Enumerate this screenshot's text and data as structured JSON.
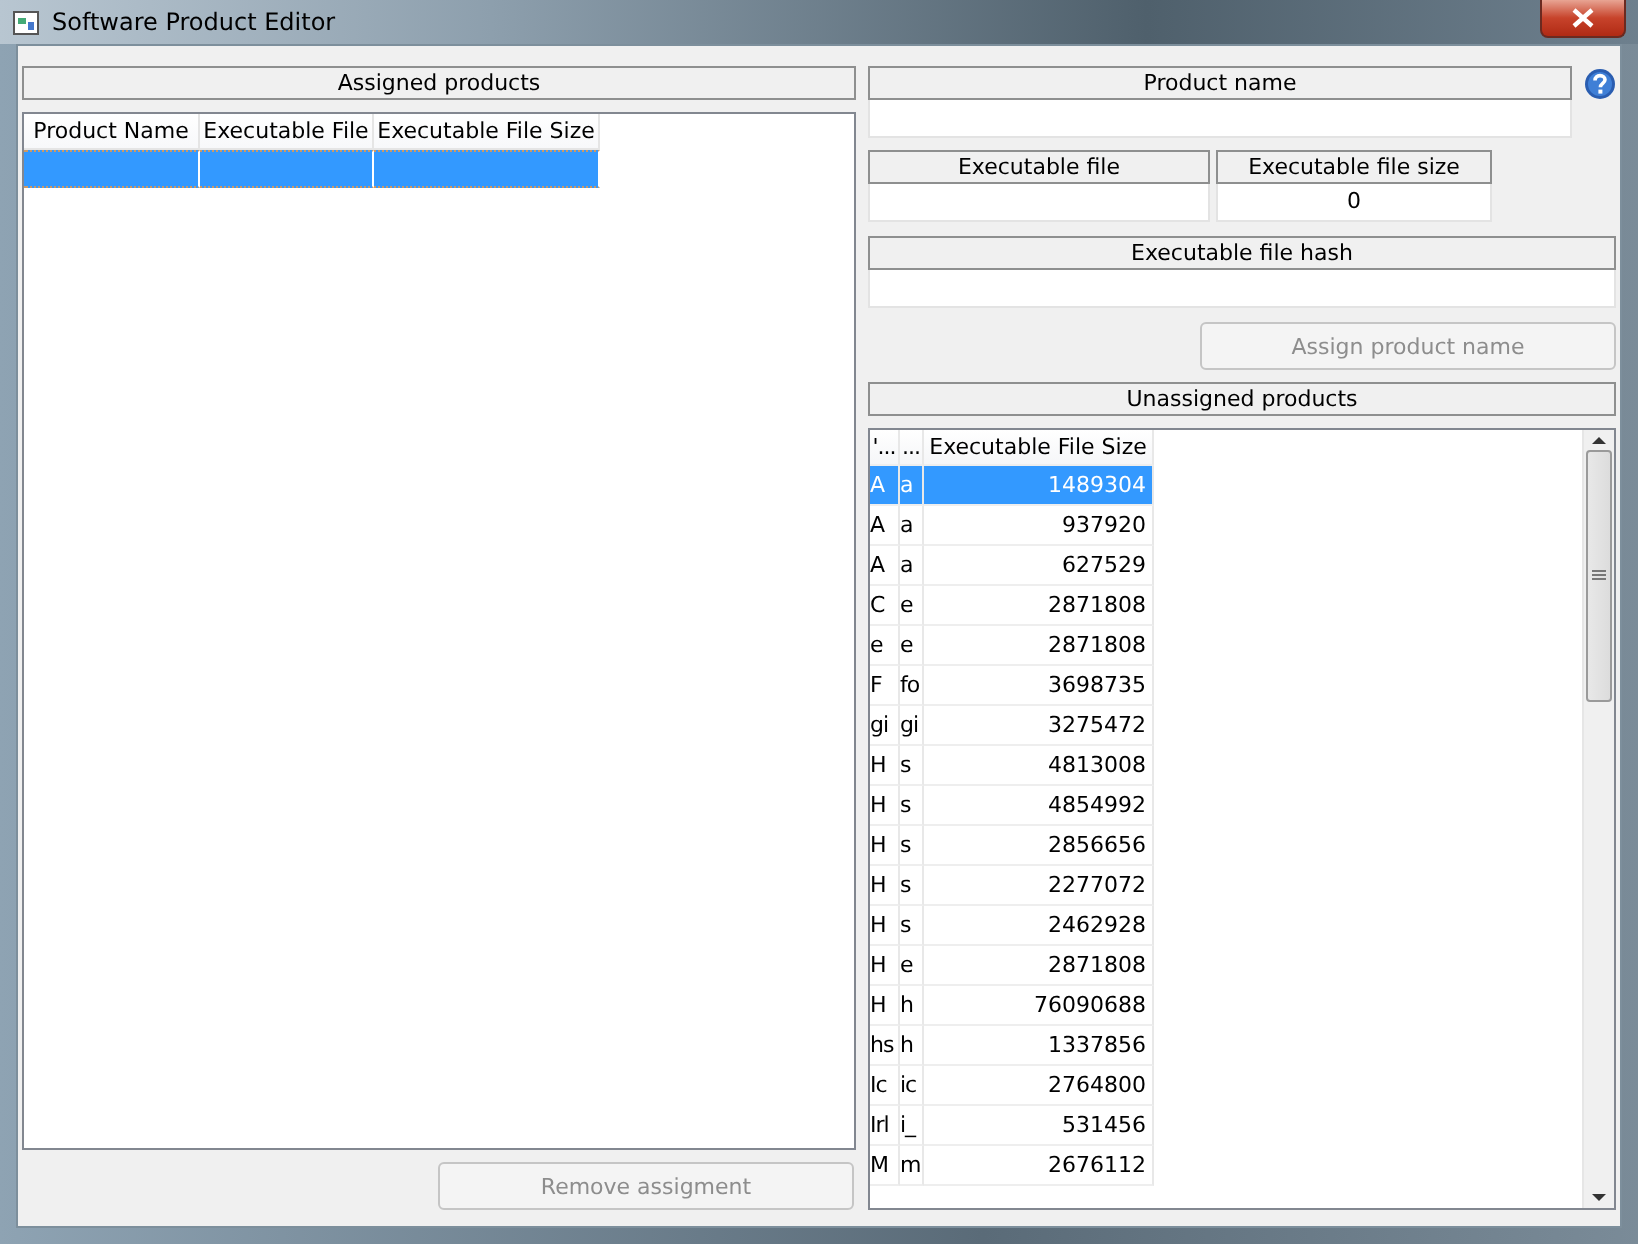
{
  "window": {
    "title": "Software Product Editor"
  },
  "assigned": {
    "title": "Assigned products",
    "columns": [
      "Product Name",
      "Executable File",
      "Executable File Size"
    ],
    "rows": [
      {
        "selected": true
      }
    ],
    "remove_button": {
      "label": "Remove assigment",
      "disabled": true
    }
  },
  "product_name": {
    "label": "Product name"
  },
  "executable_file": {
    "label": "Executable file"
  },
  "executable_file_size": {
    "label": "Executable file size",
    "value": "0"
  },
  "executable_file_hash": {
    "label": "Executable file hash"
  },
  "assign_button": {
    "label": "Assign product name",
    "disabled": true
  },
  "unassigned": {
    "title": "Unassigned products",
    "columns": [
      "'...",
      "...",
      "Executable File Size"
    ],
    "rows": [
      {
        "cells": [
          "A",
          "a",
          "1489304"
        ],
        "selected": true
      },
      {
        "cells": [
          "A",
          "a",
          "937920"
        ],
        "selected": false
      },
      {
        "cells": [
          "A",
          "a",
          "627529"
        ],
        "selected": false
      },
      {
        "cells": [
          "C",
          "e",
          "2871808"
        ],
        "selected": false
      },
      {
        "cells": [
          "e",
          "e",
          "2871808"
        ],
        "selected": false
      },
      {
        "cells": [
          "F",
          "fo",
          "3698735"
        ],
        "selected": false
      },
      {
        "cells": [
          "gi",
          "gi",
          "3275472"
        ],
        "selected": false
      },
      {
        "cells": [
          "H",
          "s",
          "4813008"
        ],
        "selected": false
      },
      {
        "cells": [
          "H",
          "s",
          "4854992"
        ],
        "selected": false
      },
      {
        "cells": [
          "H",
          "s",
          "2856656"
        ],
        "selected": false
      },
      {
        "cells": [
          "H",
          "s",
          "2277072"
        ],
        "selected": false
      },
      {
        "cells": [
          "H",
          "s",
          "2462928"
        ],
        "selected": false
      },
      {
        "cells": [
          "H",
          "e",
          "2871808"
        ],
        "selected": false
      },
      {
        "cells": [
          "H",
          "h",
          "76090688"
        ],
        "selected": false
      },
      {
        "cells": [
          "hs",
          "h",
          "1337856"
        ],
        "selected": false
      },
      {
        "cells": [
          "Ic",
          "ic",
          "2764800"
        ],
        "selected": false
      },
      {
        "cells": [
          "Irl",
          "i_",
          "531456"
        ],
        "selected": false
      },
      {
        "cells": [
          "M",
          "m",
          "2676112"
        ],
        "selected": false
      }
    ]
  }
}
